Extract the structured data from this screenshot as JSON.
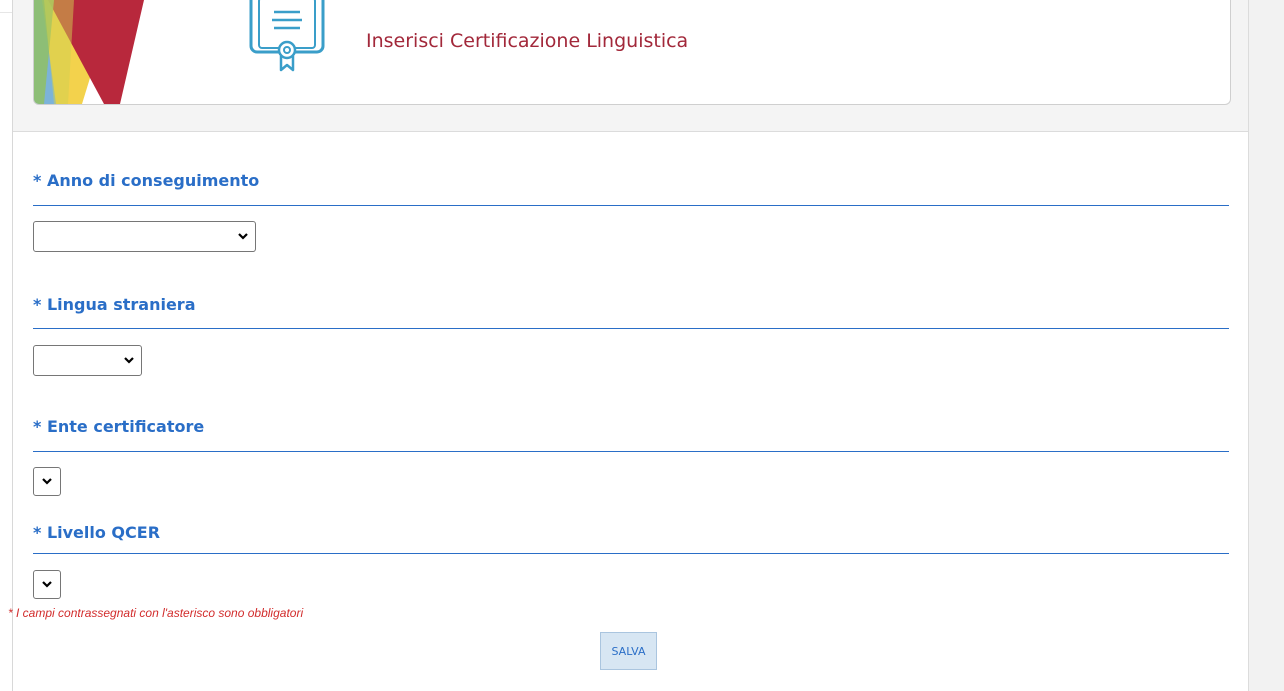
{
  "header": {
    "title": "Inserisci Certificazione Linguistica"
  },
  "form": {
    "fields": [
      {
        "label": "* Anno di conseguimento",
        "value": ""
      },
      {
        "label": "* Lingua straniera",
        "value": ""
      },
      {
        "label": "* Ente certificatore",
        "value": ""
      },
      {
        "label": "* Livello QCER",
        "value": ""
      }
    ],
    "required_note": "* I campi contrassegnati con l'asterisco sono obbligatori",
    "save_label": "SALVA"
  },
  "colors": {
    "title_red": "#a2283a",
    "label_blue": "#2a6ec7",
    "note_red": "#d22c2c",
    "button_bg": "#d7e6f3"
  },
  "icons": {
    "logo": "colored-stripes-logo",
    "header_icon": "certificate-icon",
    "select_arrow": "chevron-down-icon"
  }
}
